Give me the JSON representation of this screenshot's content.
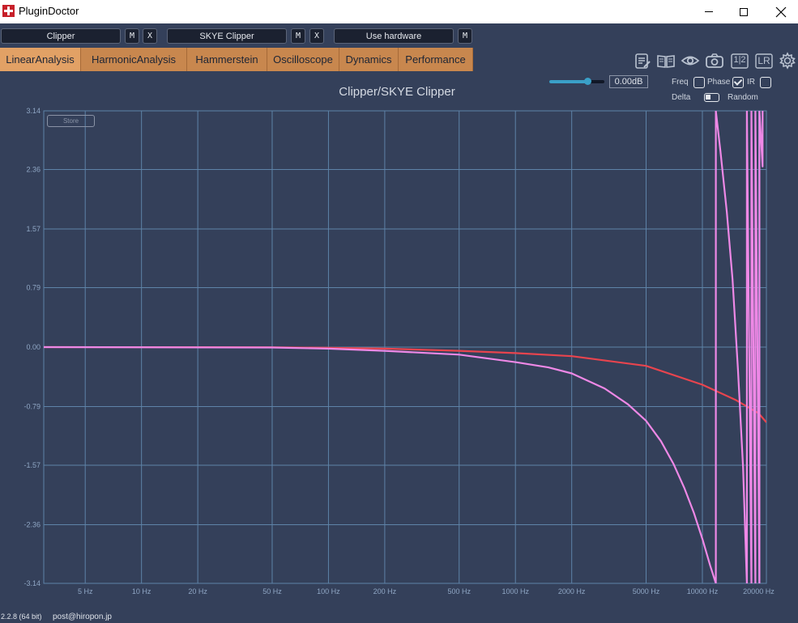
{
  "window": {
    "title": "PluginDoctor"
  },
  "slots": [
    {
      "name": "Clipper",
      "buttons": [
        "M",
        "X"
      ]
    },
    {
      "name": "SKYE Clipper",
      "buttons": [
        "M",
        "X"
      ]
    },
    {
      "name": "Use hardware",
      "buttons": [
        "M"
      ]
    }
  ],
  "tabs": [
    "LinearAnalysis",
    "HarmonicAnalysis",
    "Hammerstein",
    "Oscilloscope",
    "Dynamics",
    "Performance"
  ],
  "active_tab": "LinearAnalysis",
  "tool_icons": [
    "notes-icon",
    "book-icon",
    "eye-icon",
    "camera-icon",
    "half-icon",
    "lr-icon",
    "gear-icon"
  ],
  "tool_labels": {
    "half": "1|2",
    "lr": "LR"
  },
  "controls": {
    "gain_value": "0.00dB",
    "gain_fraction": 0.7,
    "freq_label": "Freq",
    "phase_label": "Phase",
    "ir_label": "IR",
    "delta_label": "Delta",
    "random_label": "Random",
    "freq_checked": false,
    "phase_checked": true,
    "ir_checked": false
  },
  "store_label": "Store",
  "footer": {
    "version": "2.2.8 (64 bit)",
    "email": "post@hiropon.jp"
  },
  "colors": {
    "background": "#34405a",
    "grid": "#5e83a8",
    "trace_red": "#e8444e",
    "trace_pink": "#ee88e6",
    "tab": "#c8874e"
  },
  "chart_data": {
    "type": "line",
    "title": "Clipper/SKYE Clipper",
    "x_scale": "log",
    "xlim": [
      3,
      22000
    ],
    "ylim": [
      -3.14,
      3.14
    ],
    "x_ticks": [
      {
        "value": 5,
        "label": "5 Hz"
      },
      {
        "value": 10,
        "label": "10 Hz"
      },
      {
        "value": 20,
        "label": "20 Hz"
      },
      {
        "value": 50,
        "label": "50 Hz"
      },
      {
        "value": 100,
        "label": "100 Hz"
      },
      {
        "value": 200,
        "label": "200 Hz"
      },
      {
        "value": 500,
        "label": "500 Hz"
      },
      {
        "value": 1000,
        "label": "1000 Hz"
      },
      {
        "value": 2000,
        "label": "2000 Hz"
      },
      {
        "value": 5000,
        "label": "5000 Hz"
      },
      {
        "value": 10000,
        "label": "10000 Hz"
      },
      {
        "value": 20000,
        "label": "20000 Hz"
      }
    ],
    "y_ticks": [
      3.14,
      2.36,
      1.57,
      0.79,
      0.0,
      -0.79,
      -1.57,
      -2.36,
      -3.14
    ],
    "y_tick_labels": [
      "3.14",
      "2.36",
      "1.57",
      "0.79",
      "0.00",
      "-0.79",
      "-1.57",
      "-2.36",
      "-3.14"
    ],
    "grid": true,
    "series": [
      {
        "color": "#e8444e",
        "x": [
          3,
          50,
          100,
          200,
          500,
          1000,
          2000,
          5000,
          10000,
          12000,
          15000,
          20000,
          22000
        ],
        "y": [
          0,
          -0.002,
          -0.01,
          -0.02,
          -0.05,
          -0.08,
          -0.12,
          -0.25,
          -0.5,
          -0.59,
          -0.7,
          -0.88,
          -1.0
        ]
      },
      {
        "color": "#ee88e6",
        "x": [
          3,
          50,
          100,
          200,
          500,
          1000,
          1500,
          2000,
          3000,
          4000,
          5000,
          6000,
          7000,
          8000,
          9000,
          10000,
          11000,
          11800,
          11800,
          12500,
          13500,
          14500,
          15500,
          16500,
          17300,
          17300,
          18300,
          18300,
          19200,
          19200,
          20200,
          20200,
          21000,
          21000
        ],
        "y": [
          0,
          -0.005,
          -0.02,
          -0.05,
          -0.1,
          -0.2,
          -0.27,
          -0.35,
          -0.55,
          -0.76,
          -0.98,
          -1.25,
          -1.55,
          -1.87,
          -2.2,
          -2.55,
          -2.9,
          -3.14,
          3.14,
          2.6,
          1.8,
          0.9,
          -0.3,
          -1.6,
          -3.14,
          3.14,
          -3.14,
          3.14,
          -3.14,
          3.14,
          -3.14,
          3.14,
          2.4,
          3.14
        ]
      }
    ]
  }
}
